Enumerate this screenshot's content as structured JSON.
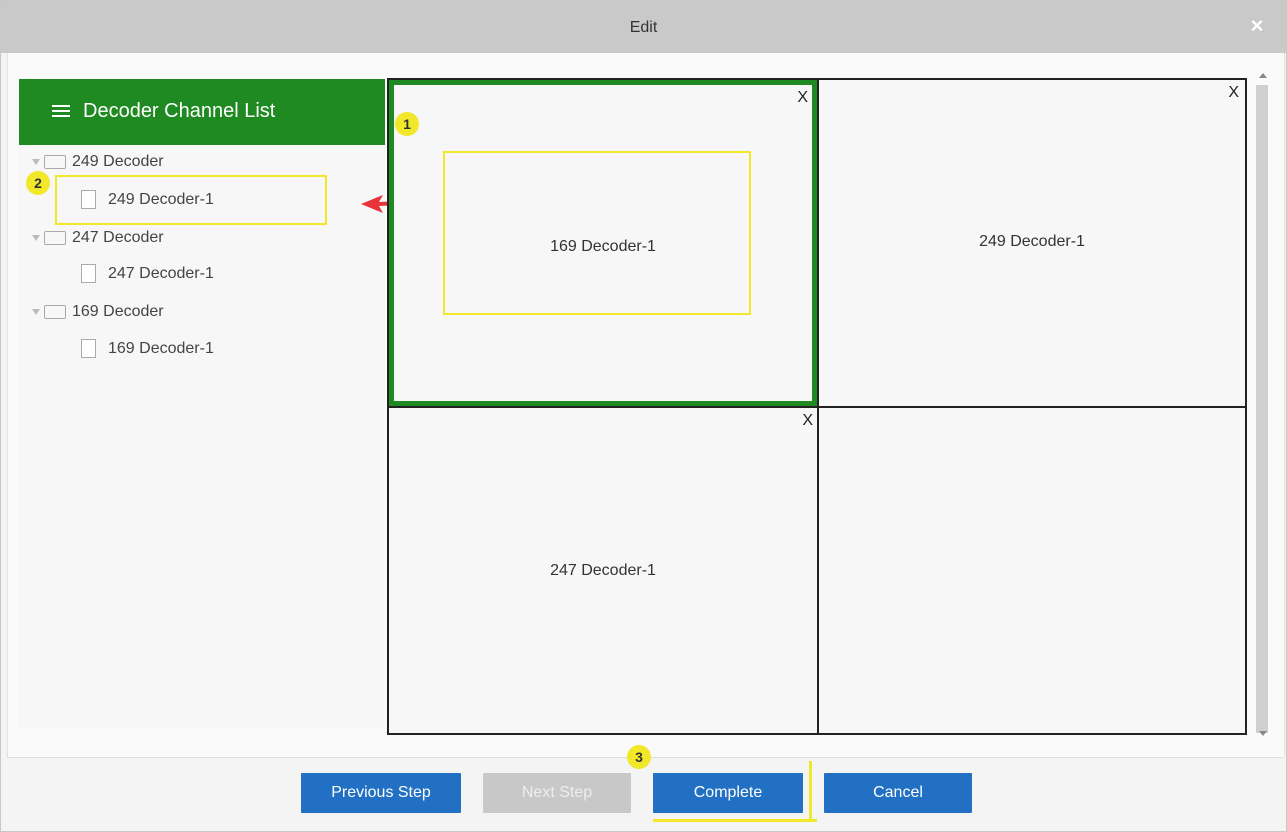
{
  "dialog": {
    "title": "Edit",
    "close_label": "×"
  },
  "sidebar": {
    "title": "Decoder Channel List",
    "tree": [
      {
        "group": "249 Decoder",
        "child": "249 Decoder-1"
      },
      {
        "group": "247 Decoder",
        "child": "247 Decoder-1"
      },
      {
        "group": "169 Decoder",
        "child": "169 Decoder-1"
      }
    ]
  },
  "grid": {
    "cells": [
      {
        "label": "169 Decoder-1",
        "close": "X",
        "selected": true
      },
      {
        "label": "249 Decoder-1",
        "close": "X"
      },
      {
        "label": "247 Decoder-1",
        "close": "X"
      },
      {
        "label": ""
      }
    ]
  },
  "annotations": {
    "step1": "1",
    "step2": "2",
    "step3": "3"
  },
  "footer": {
    "previous": "Previous Step",
    "next": "Next Step",
    "complete": "Complete",
    "cancel": "Cancel"
  },
  "colors": {
    "accent": "#1f8a21",
    "button": "#2270c3",
    "highlight": "#f2e82a",
    "arrow": "#e8333a"
  }
}
